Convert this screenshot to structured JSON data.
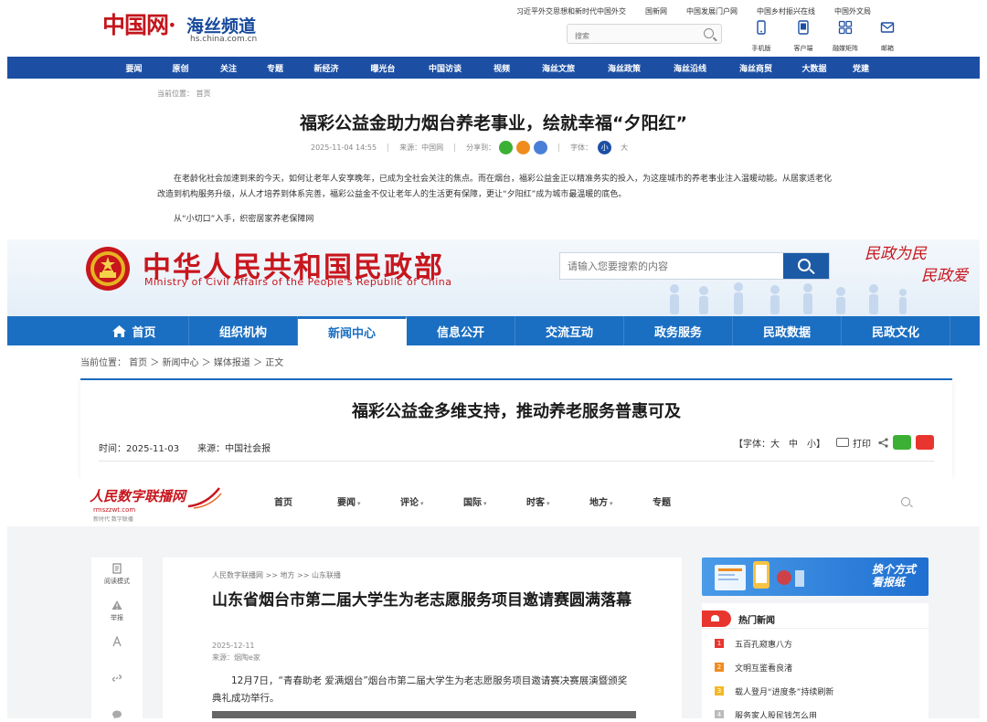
{
  "panel1": {
    "logo": {
      "zh": "中国网·",
      "channel": "海丝频道",
      "url": "hs.china.com.cn"
    },
    "top_links": [
      "习近平外交思想和新时代中国外交",
      "国新网",
      "中国发展门户网",
      "中国乡村振兴在线",
      "中国外文局"
    ],
    "search_placeholder": "搜索",
    "tools": [
      {
        "label": "手机版",
        "icon": "mobile-icon"
      },
      {
        "label": "客户端",
        "icon": "app-icon"
      },
      {
        "label": "融媒矩阵",
        "icon": "matrix-icon"
      },
      {
        "label": "邮箱",
        "icon": "mail-icon"
      }
    ],
    "nav": [
      "要闻",
      "原创",
      "关注",
      "专题",
      "新经济",
      "曝光台",
      "中国访谈",
      "视频",
      "海丝文旅",
      "海丝政策",
      "海丝沿线",
      "海丝商贸",
      "大数据",
      "党建"
    ],
    "breadcrumb": "当前位置： 首页",
    "title": "福彩公益金助力烟台养老事业，绘就幸福“夕阳红”",
    "meta": {
      "datetime": "2025-11-04 14:55",
      "source": "来源：中国网",
      "share_label": "分享到：",
      "font_label": "字体：",
      "font_small": "小",
      "font_large": "大"
    },
    "colors": {
      "brand_blue": "#1c4fa4",
      "brand_red": "#c3161c",
      "wechat": "#3cb034",
      "weibo": "#f08c1e",
      "link": "#4a7fd8"
    },
    "paragraphs": [
      "在老龄化社会加速到来的今天，如何让老年人安享晚年，已成为全社会关注的焦点。而在烟台，福彩公益金正以精准务实的投入，为这座城市的养老事业注入温暖动能。从居家适老化改造到机构服务升级，从人才培养到体系完善，福彩公益金不仅让老年人的生活更有保障，更让“夕阳红”成为城市最温暖的底色。",
      "从“小切口”入手，织密居家养老保障网"
    ]
  },
  "panel2": {
    "title_zh": "中华人民共和国民政部",
    "title_en": "Ministry of Civil Affairs of the People's Republic of China",
    "search_placeholder": "请输入您要搜索的内容",
    "slogan": [
      "民政为民",
      "民政爱"
    ],
    "nav": [
      "首页",
      "组织机构",
      "新闻中心",
      "信息公开",
      "交流互动",
      "政务服务",
      "民政数据",
      "民政文化"
    ],
    "active_nav": "新闻中心",
    "breadcrumb": "当前位置： 首页 ＞ 新闻中心 ＞ 媒体报道 ＞ 正文",
    "article_title": "福彩公益金多维支持，推动养老服务普惠可及",
    "meta": "时间：2025-11-03　　来源：中国社会报",
    "font_tools": "【字体：大　中　小】",
    "print_label": "打印",
    "colors": {
      "red": "#c8161d",
      "blue": "#1b6fc2",
      "wechat": "#3cb034",
      "weibo": "#e8352e"
    }
  },
  "panel3": {
    "logo": {
      "text": "人民数字联播网",
      "url": "rmszzwt.com",
      "slogan": "新时代 数字联播"
    },
    "nav": [
      {
        "label": "首页",
        "dropdown": false
      },
      {
        "label": "要闻",
        "dropdown": true
      },
      {
        "label": "评论",
        "dropdown": true
      },
      {
        "label": "国际",
        "dropdown": true
      },
      {
        "label": "时客",
        "dropdown": true
      },
      {
        "label": "地方",
        "dropdown": true
      },
      {
        "label": "专题",
        "dropdown": false
      }
    ],
    "left_tools": [
      {
        "label": "阅读模式",
        "icon": "reading-mode-icon"
      },
      {
        "label": "举报",
        "icon": "warning-icon"
      },
      {
        "label": "",
        "icon": "font-size-icon"
      },
      {
        "label": "",
        "icon": "link-icon"
      },
      {
        "label": "",
        "icon": "comment-icon"
      }
    ],
    "breadcrumb": "人民数字联播网 >> 地方 >> 山东联播",
    "title": "山东省烟台市第二届大学生为老志愿服务项目邀请赛圆满落幕",
    "date": "2025-12-11",
    "source": "来源：烟陶e家",
    "body": "12月7日，“青春助老 爱满烟台”烟台市第二届大学生为老志愿服务项目邀请赛决赛展演暨颁奖典礼成功举行。",
    "banner": [
      "换个方式",
      "看报纸"
    ],
    "hot_title": "热门新闻",
    "hot_news": [
      {
        "num": "1",
        "text": "五百孔窥惠八方",
        "color": "#e8352e"
      },
      {
        "num": "2",
        "text": "文明互鉴看良渚",
        "color": "#f08c1e"
      },
      {
        "num": "3",
        "text": "载人登月“进度条”持续刷新",
        "color": "#f5b823"
      },
      {
        "num": "4",
        "text": "服务家人股民钱怎么用",
        "color": "#bbbbbb"
      }
    ]
  }
}
